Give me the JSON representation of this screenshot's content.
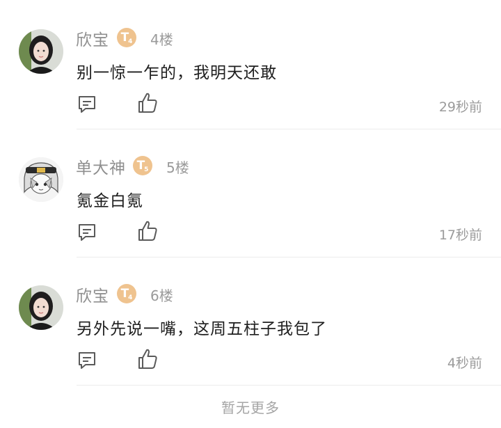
{
  "comments": [
    {
      "user": "欣宝",
      "badge_level": "T",
      "badge_sub": "4",
      "floor": "4楼",
      "text": "别一惊一乍的，我明天还敢",
      "time": "29秒前",
      "avatar": "girl-portrait"
    },
    {
      "user": "单大神",
      "badge_level": "T",
      "badge_sub": "5",
      "floor": "5楼",
      "text": "氪金白氪",
      "time": "17秒前",
      "avatar": "anime-character"
    },
    {
      "user": "欣宝",
      "badge_level": "T",
      "badge_sub": "4",
      "floor": "6楼",
      "text": "另外先说一嘴，这周五柱子我包了",
      "time": "4秒前",
      "avatar": "girl-portrait"
    }
  ],
  "footer": {
    "text": "暂无更多"
  },
  "colors": {
    "badge": "#efc38f",
    "username": "#8f8f8f",
    "meta": "#9b9b9b"
  }
}
